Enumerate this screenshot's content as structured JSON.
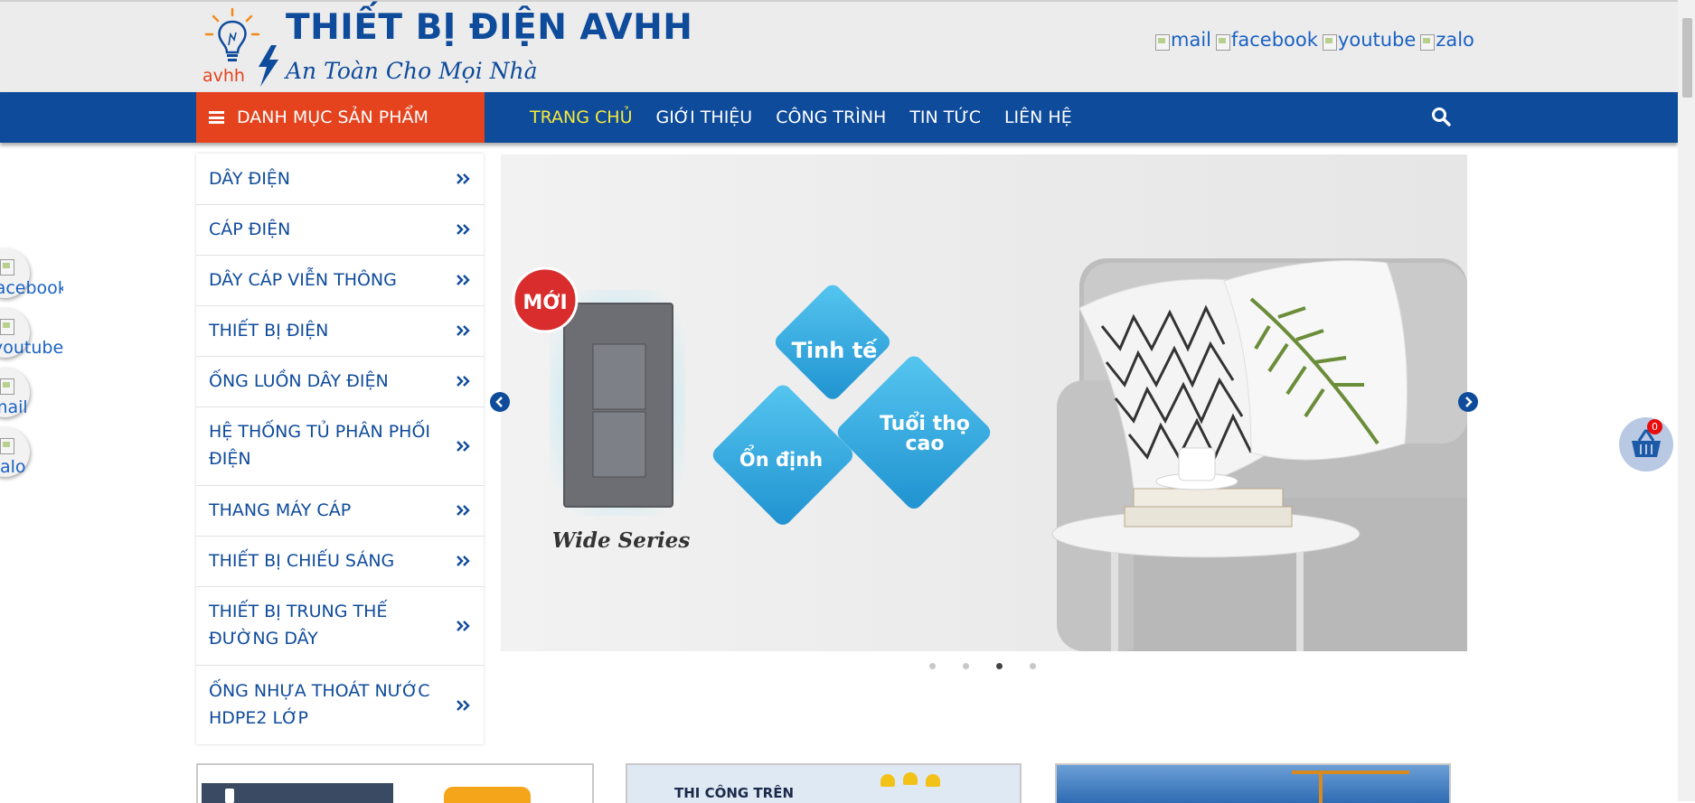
{
  "header": {
    "brand_title": "THIẾT BỊ ĐIỆN AVHH",
    "slogan": "An Toàn Cho Mọi Nhà",
    "logo_text": "avhh",
    "social": [
      {
        "label": "mail",
        "icon": "mail-icon"
      },
      {
        "label": "facebook",
        "icon": "facebook-icon"
      },
      {
        "label": "youtube",
        "icon": "youtube-icon"
      },
      {
        "label": "zalo",
        "icon": "zalo-icon"
      }
    ]
  },
  "nav": {
    "category_button": "DANH MỤC SẢN PHẨM",
    "items": [
      {
        "label": "TRANG CHỦ",
        "active": true
      },
      {
        "label": "GIỚI THIỆU"
      },
      {
        "label": "CÔNG TRÌNH"
      },
      {
        "label": "TIN TỨC"
      },
      {
        "label": "LIÊN HỆ"
      }
    ]
  },
  "sidebar": {
    "items": [
      {
        "label": "DÂY ĐIỆN"
      },
      {
        "label": "CÁP ĐIỆN"
      },
      {
        "label": "DÂY CÁP VIỄN THÔNG"
      },
      {
        "label": "THIẾT BỊ ĐIỆN"
      },
      {
        "label": "ỐNG LUỒN DÂY ĐIỆN"
      },
      {
        "label": "HỆ THỐNG TỦ PHÂN PHỐI ĐIỆN"
      },
      {
        "label": "THANG MÁY CÁP"
      },
      {
        "label": "THIẾT BỊ CHIẾU SÁNG"
      },
      {
        "label": "THIẾT BỊ TRUNG THẾ ĐƯỜNG DÂY"
      },
      {
        "label": "ỐNG NHỰA THOÁT NƯỚC HDPE2 LỚP"
      }
    ]
  },
  "slider": {
    "badge": "MỚI",
    "product_caption": "Wide Series",
    "features": [
      "Tinh tế",
      "Ổn định",
      "Tuổi thọ cao"
    ],
    "dot_count": 4,
    "active_dot": 3
  },
  "floating_social": [
    {
      "label": "facebook",
      "icon": "facebook-icon"
    },
    {
      "label": "youtube",
      "icon": "youtube-icon"
    },
    {
      "label": "mail",
      "icon": "mail-icon"
    },
    {
      "label": "zalo",
      "icon": "zalo-icon"
    }
  ],
  "cart": {
    "count": "0"
  },
  "cards": [
    {
      "text": ""
    },
    {
      "text": "THI CÔNG TRÊN"
    },
    {
      "text": ""
    }
  ],
  "colors": {
    "brand_blue": "#0f4b9b",
    "accent_orange": "#e4431e",
    "active_yellow": "#f6eb3a"
  }
}
